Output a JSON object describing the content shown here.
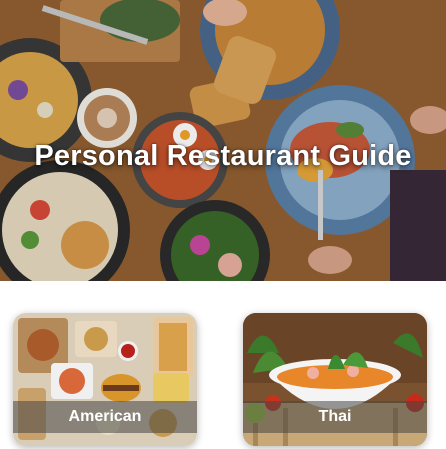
{
  "hero": {
    "title": "Personal Restaurant Guide",
    "image_alt": "food-spread-photo"
  },
  "cuisines": [
    {
      "label": "American",
      "image": "fast-food-photo"
    },
    {
      "label": "Thai",
      "image": "thai-soup-photo"
    }
  ],
  "colors": {
    "title_text": "#ffffff",
    "label_overlay": "rgba(70,70,70,0.55)",
    "table_wood": "#8a5a2e",
    "plate_blue": "#4a6a90"
  }
}
